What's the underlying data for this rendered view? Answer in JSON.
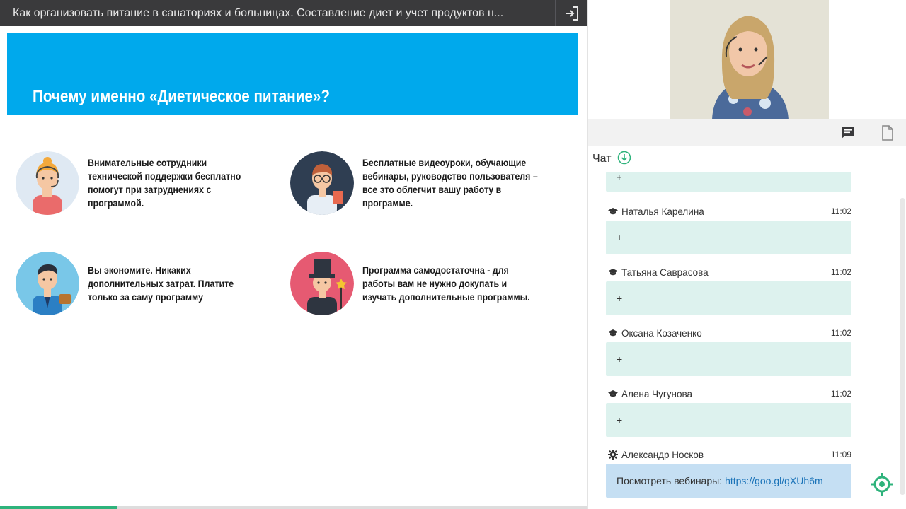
{
  "window": {
    "title": "Как организовать питание в санаториях и больницах. Составление диет и учет продуктов н..."
  },
  "slide": {
    "title": "Почему именно «Диетическое питание»?",
    "features": [
      {
        "text": "Внимательные сотрудники технической поддержки бесплатно помогут при затруднениях с программой.",
        "icon": "support-agent-icon"
      },
      {
        "text": "Бесплатные видеоуроки, обучающие вебинары, руководство пользователя – все это облегчит вашу работу в программе.",
        "icon": "teacher-icon"
      },
      {
        "text": "Вы экономите. Никаких дополнительных затрат.  Платите только за саму программу",
        "icon": "businessman-icon"
      },
      {
        "text": "Программа самодостаточна - для работы вам не нужно докупать и изучать дополнительные программы.",
        "icon": "magician-icon"
      }
    ],
    "progress": 0.2
  },
  "chat": {
    "label": "Чат",
    "partial_text": "+",
    "messages": [
      {
        "author": "Наталья Карелина",
        "time": "11:02",
        "text": "+",
        "role": "student"
      },
      {
        "author": "Татьяна Саврасова",
        "time": "11:02",
        "text": "+",
        "role": "student"
      },
      {
        "author": "Оксана Козаченко",
        "time": "11:02",
        "text": "+",
        "role": "student"
      },
      {
        "author": "Алена Чугунова",
        "time": "11:02",
        "text": "+",
        "role": "student"
      },
      {
        "author": "Александр Носков",
        "time": "11:09",
        "text": "Посмотреть вебинары:",
        "link": "https://goo.gl/gXUh6m",
        "role": "admin"
      }
    ]
  },
  "colors": {
    "banner": "#00a9ec",
    "chat_bubble": "#ddf2ee",
    "admin_bubble": "#c5dff3",
    "accent": "#2fb37c"
  }
}
